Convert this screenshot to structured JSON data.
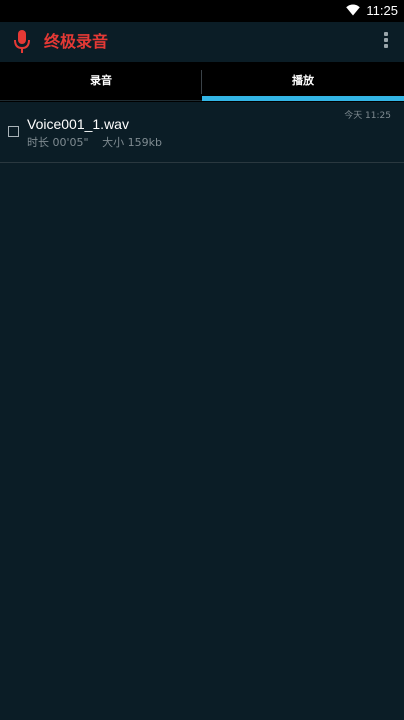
{
  "status_bar": {
    "time": "11:25",
    "wifi_icon": "wifi-icon"
  },
  "app_bar": {
    "icon": "microphone-icon",
    "title": "终极录音",
    "menu_icon": "more-vertical-icon",
    "title_color": "#e53935"
  },
  "tabs": [
    {
      "label": "录音",
      "selected": false
    },
    {
      "label": "播放",
      "selected": true
    }
  ],
  "colors": {
    "background": "#0b1d26",
    "tab_indicator": "#33b5e5",
    "accent": "#e53935"
  },
  "recordings": [
    {
      "name": "Voice001_1.wav",
      "duration": "时长 00'05\"",
      "size": "大小 159kb",
      "date": "今天 11:25",
      "checked": false
    }
  ]
}
